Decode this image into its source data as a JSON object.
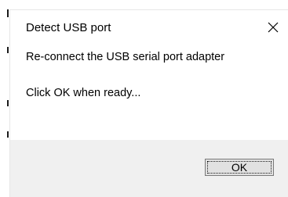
{
  "dialog": {
    "title": "Detect USB port",
    "close_icon": "close-icon",
    "messages": [
      "Re-connect the USB serial port adapter",
      "Click OK when ready..."
    ],
    "ok_label": "OK"
  },
  "colors": {
    "dialog_background": "#ffffff",
    "footer_background": "#f0f0f0",
    "button_face": "#e1e1e1",
    "button_border": "#7a7a7a",
    "text": "#000000"
  }
}
